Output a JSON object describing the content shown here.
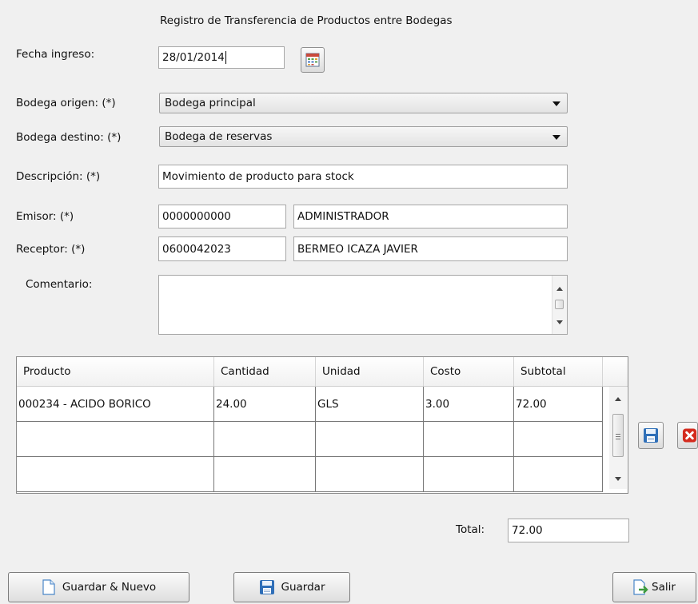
{
  "header": {
    "title": "Registro de Transferencia de Productos entre Bodegas"
  },
  "form": {
    "fecha_label": "Fecha ingreso:",
    "fecha_value": "28/01/2014",
    "origen_label": "Bodega origen: (*)",
    "origen_value": "Bodega principal",
    "destino_label": "Bodega destino: (*)",
    "destino_value": "Bodega de reservas",
    "descripcion_label": "Descripción: (*)",
    "descripcion_value": "Movimiento de producto para stock",
    "emisor_label": "Emisor: (*)",
    "emisor_id": "0000000000",
    "emisor_name": "ADMINISTRADOR",
    "receptor_label": "Receptor: (*)",
    "receptor_id": "0600042023",
    "receptor_name": "BERMEO ICAZA JAVIER",
    "comentario_label": "Comentario:",
    "comentario_value": ""
  },
  "table": {
    "columns": [
      "Producto",
      "Cantidad",
      "Unidad",
      "Costo",
      "Subtotal"
    ],
    "rows": [
      [
        "000234 - ACIDO BORICO",
        "24.00",
        "GLS",
        "3.00",
        "72.00"
      ],
      [
        "",
        "",
        "",
        "",
        ""
      ],
      [
        "",
        "",
        "",
        "",
        ""
      ]
    ]
  },
  "totals": {
    "label": "Total:",
    "value": "72.00"
  },
  "buttons": {
    "guardar_nuevo": "Guardar & Nuevo",
    "guardar": "Guardar",
    "salir": "Salir"
  },
  "icons": {
    "calendar": "calendar-icon",
    "save_row": "floppy-disk-icon",
    "delete_row": "delete-x-icon",
    "document": "document-icon",
    "exit": "exit-door-icon"
  },
  "colors": {
    "delete_red": "#d42b1e",
    "floppy_blue": "#2f6fb8"
  }
}
